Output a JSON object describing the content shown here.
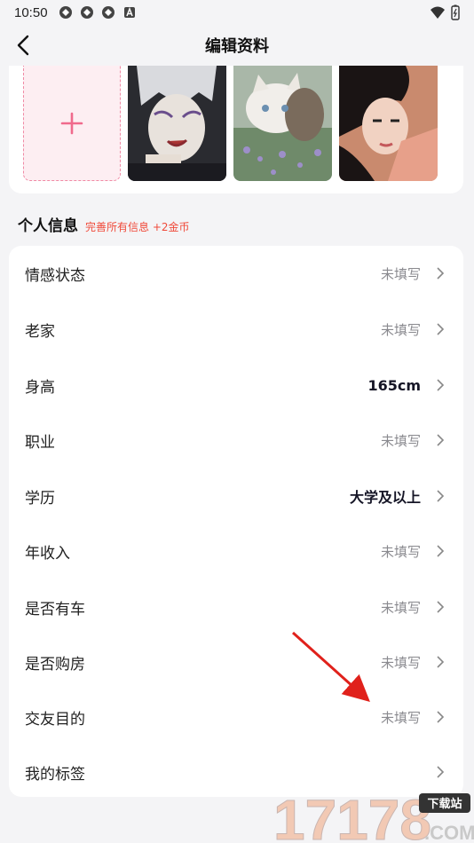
{
  "status_bar": {
    "time": "10:50"
  },
  "header": {
    "title": "编辑资料"
  },
  "photos": {
    "add_label": "+"
  },
  "section": {
    "title": "个人信息",
    "subtitle": "完善所有信息 +2金币"
  },
  "rows": [
    {
      "label": "情感状态",
      "value": "未填写",
      "filled": false
    },
    {
      "label": "老家",
      "value": "未填写",
      "filled": false
    },
    {
      "label": "身高",
      "value": "165cm",
      "filled": true
    },
    {
      "label": "职业",
      "value": "未填写",
      "filled": false
    },
    {
      "label": "学历",
      "value": "大学及以上",
      "filled": true
    },
    {
      "label": "年收入",
      "value": "未填写",
      "filled": false
    },
    {
      "label": "是否有车",
      "value": "未填写",
      "filled": false
    },
    {
      "label": "是否购房",
      "value": "未填写",
      "filled": false
    },
    {
      "label": "交友目的",
      "value": "未填写",
      "filled": false
    },
    {
      "label": "我的标签",
      "value": "",
      "filled": false
    }
  ],
  "watermark": {
    "text": "17178",
    "badge": "下载站",
    "domain": ".COM"
  },
  "colors": {
    "accent": "#f04a3a",
    "pink": "#f06a8c",
    "background": "#f4f4f6"
  }
}
